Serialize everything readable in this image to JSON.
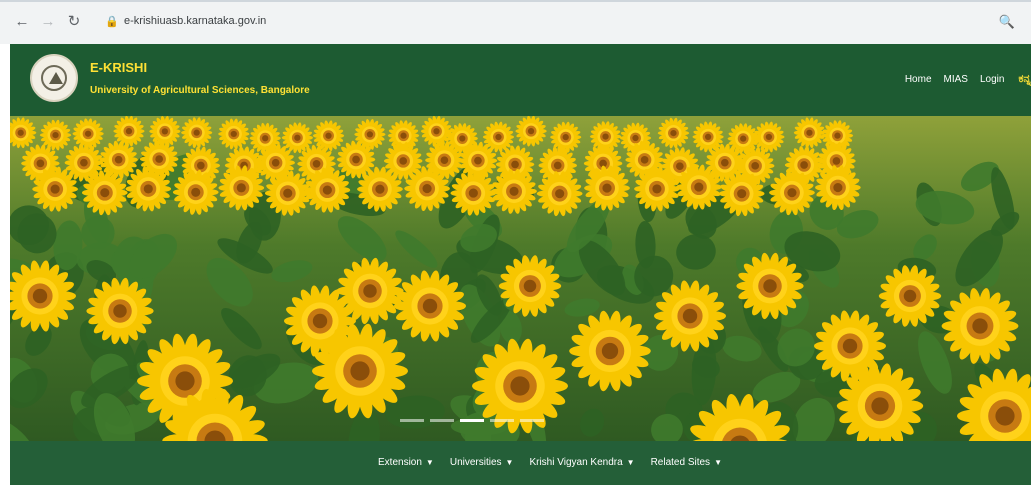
{
  "browser": {
    "url": "e-krishiuasb.karnataka.gov.in"
  },
  "header": {
    "title": "E-KRISHI",
    "subtitle": "University of Agricultural Sciences, Bangalore",
    "nav": [
      "Home",
      "MIAS",
      "Login"
    ],
    "lang_label": "ಕನ್ನ"
  },
  "carousel": {
    "slide_count": 5,
    "active_index": 2
  },
  "bottom_nav": {
    "items": [
      "Extension",
      "Universities",
      "Krishi Vigyan Kendra",
      "Related Sites"
    ]
  },
  "colors": {
    "header_bg": "#1d5b32",
    "accent_yellow": "#ffe135",
    "bottom_nav_bg": "#245f38"
  }
}
